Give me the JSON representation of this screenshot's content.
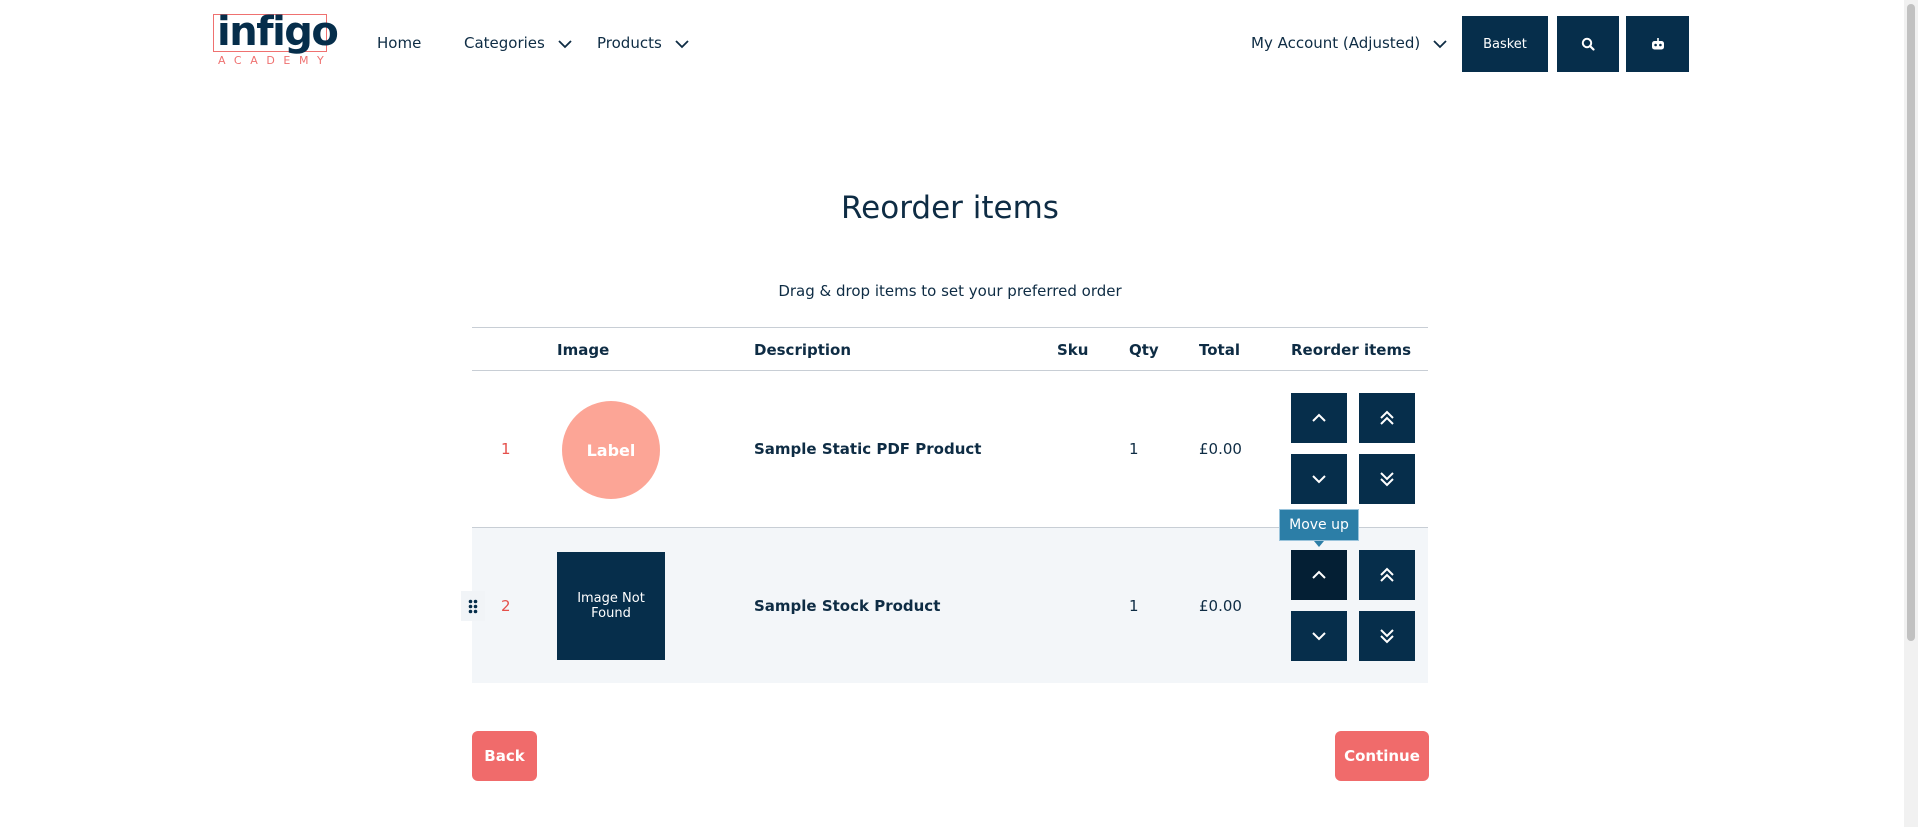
{
  "header": {
    "logo": {
      "word": "infigo",
      "sub": "ACADEMY"
    },
    "nav": [
      {
        "label": "Home"
      },
      {
        "label": "Categories"
      },
      {
        "label": "Products"
      }
    ],
    "account_label": "My Account (Adjusted)",
    "basket_label": "Basket",
    "search_icon": "search-icon",
    "extra_icon": "robot-icon"
  },
  "page": {
    "title": "Reorder items",
    "subtitle": "Drag & drop items to set your preferred order"
  },
  "table": {
    "columns": [
      "Image",
      "Description",
      "Sku",
      "Qty",
      "Total",
      "Reorder items"
    ],
    "rows": [
      {
        "index": "1",
        "image_label": "Label",
        "description": "Sample Static PDF Product",
        "sku": "",
        "qty": "1",
        "total": "£0.00"
      },
      {
        "index": "2",
        "image_label": "Image Not Found",
        "description": "Sample Stock Product",
        "sku": "",
        "qty": "1",
        "total": "£0.00"
      }
    ]
  },
  "reorder_buttons": {
    "move_up": "chevron-up-icon",
    "move_top": "double-chevron-up-icon",
    "move_down": "chevron-down-icon",
    "move_bottom": "double-chevron-down-icon"
  },
  "tooltip": "Move up",
  "actions": {
    "back": "Back",
    "continue": "Continue"
  },
  "colors": {
    "navy": "#062e4b",
    "accent": "#f06b6b",
    "label_circle": "#fca596",
    "tooltip": "#2c7ea7",
    "row_highlight": "#f3f6f9"
  }
}
